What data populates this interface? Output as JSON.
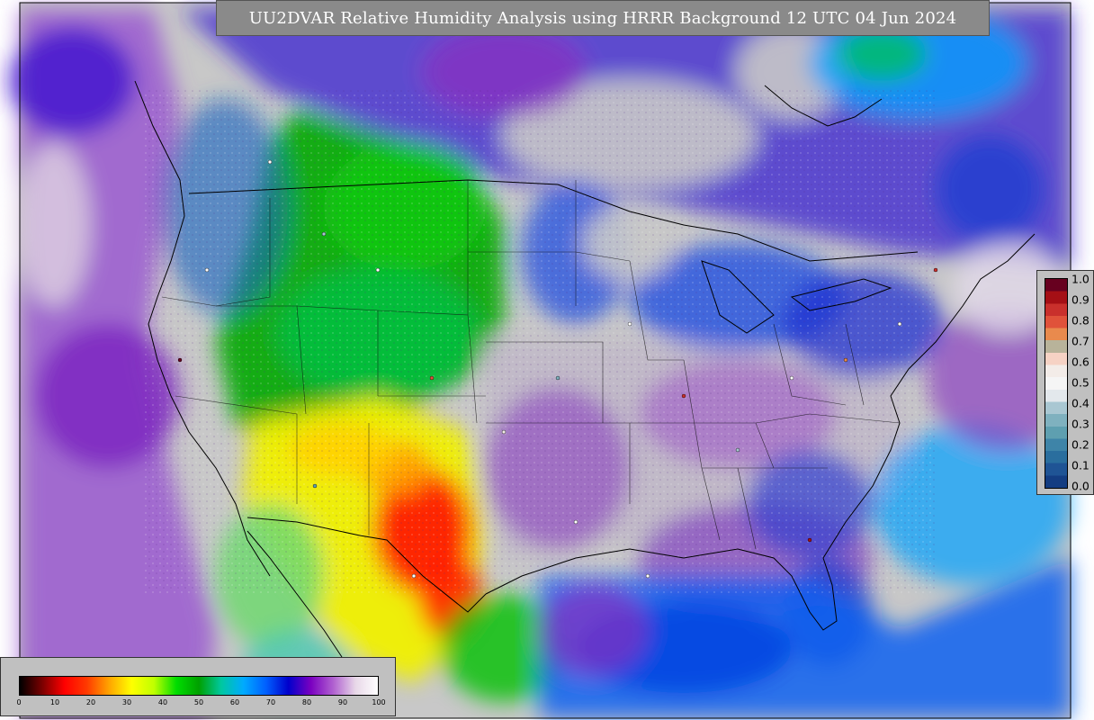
{
  "title": "UU2DVAR Relative Humidity Analysis using HRRR Background 12 UTC 04 Jun 2024",
  "obs_colorbar": {
    "ticks": [
      "1.0",
      "0.9",
      "0.8",
      "0.7",
      "0.6",
      "0.5",
      "0.4",
      "0.3",
      "0.2",
      "0.1",
      "0.0"
    ],
    "colors_top_to_bottom": [
      "#67001f",
      "#a50f15",
      "#c9302c",
      "#e0523a",
      "#e98a4d",
      "#b8b39a",
      "#f6d2c4",
      "#f3ece8",
      "#f5f5f5",
      "#e3e8ec",
      "#a9c7d2",
      "#7fb1bf",
      "#5e9fb0",
      "#3e84a8",
      "#2a6e9e",
      "#1f5495",
      "#143d82"
    ]
  },
  "rh_colorbar": {
    "ticks": [
      "0",
      "10",
      "20",
      "30",
      "40",
      "50",
      "60",
      "70",
      "80",
      "90",
      "100"
    ],
    "stops": [
      "#000000",
      "#7a0000",
      "#ff0000",
      "#ff3a00",
      "#ffa500",
      "#ffff00",
      "#bfff00",
      "#00dd00",
      "#00a000",
      "#00c8a0",
      "#00aaff",
      "#0060ff",
      "#0000cc",
      "#7a00c0",
      "#b060d0",
      "#e8d8e8",
      "#ffffff"
    ]
  },
  "colors": {
    "land_dry": "#ff0000",
    "land_mid": "#ffff00",
    "land_green": "#00c000",
    "moist_blue": "#0040e0",
    "humid_purple": "#8000c0",
    "saturated_gray": "#c8c8c8"
  }
}
